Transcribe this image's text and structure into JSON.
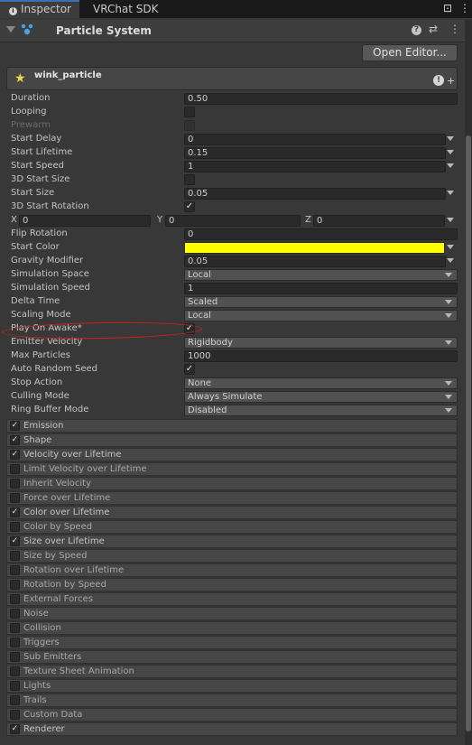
{
  "tabs": {
    "inspector": "Inspector",
    "vrchat": "VRChat SDK"
  },
  "component": {
    "title": "Particle System",
    "help_glyph": "?",
    "preset_glyph": "⇄",
    "menu_glyph": "⋮"
  },
  "open_editor": "Open Editor...",
  "system": {
    "name": "wink_particle",
    "info_glyph": "!",
    "plus_glyph": "+"
  },
  "properties": {
    "duration": {
      "label": "Duration",
      "value": "0.50"
    },
    "looping": {
      "label": "Looping",
      "checked": false
    },
    "prewarm": {
      "label": "Prewarm",
      "checked": false
    },
    "start_delay": {
      "label": "Start Delay",
      "value": "0"
    },
    "start_lifetime": {
      "label": "Start Lifetime",
      "value": "0.15"
    },
    "start_speed": {
      "label": "Start Speed",
      "value": "1"
    },
    "start_size_3d": {
      "label": "3D Start Size",
      "checked": false
    },
    "start_size": {
      "label": "Start Size",
      "value": "0.05"
    },
    "start_rotation_3d": {
      "label": "3D Start Rotation",
      "checked": true,
      "check_glyph": "✓"
    },
    "rotation_xyz": {
      "x_label": "X",
      "x_value": "0",
      "y_label": "Y",
      "y_value": "0",
      "z_label": "Z",
      "z_value": "0"
    },
    "flip_rotation": {
      "label": "Flip Rotation",
      "value": "0"
    },
    "start_color": {
      "label": "Start Color",
      "color": "#ffff00"
    },
    "gravity_modifier": {
      "label": "Gravity Modifier",
      "value": "0.05"
    },
    "simulation_space": {
      "label": "Simulation Space",
      "value": "Local"
    },
    "simulation_speed": {
      "label": "Simulation Speed",
      "value": "1"
    },
    "delta_time": {
      "label": "Delta Time",
      "value": "Scaled"
    },
    "scaling_mode": {
      "label": "Scaling Mode",
      "value": "Local"
    },
    "play_on_awake": {
      "label": "Play On Awake*",
      "checked": true,
      "check_glyph": "✓"
    },
    "emitter_velocity": {
      "label": "Emitter Velocity",
      "value": "Rigidbody"
    },
    "max_particles": {
      "label": "Max Particles",
      "value": "1000"
    },
    "auto_random_seed": {
      "label": "Auto Random Seed",
      "checked": true,
      "check_glyph": "✓"
    },
    "stop_action": {
      "label": "Stop Action",
      "value": "None"
    },
    "culling_mode": {
      "label": "Culling Mode",
      "value": "Always Simulate"
    },
    "ring_buffer_mode": {
      "label": "Ring Buffer Mode",
      "value": "Disabled"
    }
  },
  "modules": [
    {
      "label": "Emission",
      "checked": true,
      "check_glyph": "✓"
    },
    {
      "label": "Shape",
      "checked": true,
      "check_glyph": "✓"
    },
    {
      "label": "Velocity over Lifetime",
      "checked": true,
      "check_glyph": "✓"
    },
    {
      "label": "Limit Velocity over Lifetime",
      "checked": false,
      "check_glyph": ""
    },
    {
      "label": "Inherit Velocity",
      "checked": false,
      "check_glyph": ""
    },
    {
      "label": "Force over Lifetime",
      "checked": false,
      "check_glyph": ""
    },
    {
      "label": "Color over Lifetime",
      "checked": true,
      "check_glyph": "✓"
    },
    {
      "label": "Color by Speed",
      "checked": false,
      "check_glyph": ""
    },
    {
      "label": "Size over Lifetime",
      "checked": true,
      "check_glyph": "✓"
    },
    {
      "label": "Size by Speed",
      "checked": false,
      "check_glyph": ""
    },
    {
      "label": "Rotation over Lifetime",
      "checked": false,
      "check_glyph": ""
    },
    {
      "label": "Rotation by Speed",
      "checked": false,
      "check_glyph": ""
    },
    {
      "label": "External Forces",
      "checked": false,
      "check_glyph": ""
    },
    {
      "label": "Noise",
      "checked": false,
      "check_glyph": ""
    },
    {
      "label": "Collision",
      "checked": false,
      "check_glyph": ""
    },
    {
      "label": "Triggers",
      "checked": false,
      "check_glyph": ""
    },
    {
      "label": "Sub Emitters",
      "checked": false,
      "check_glyph": ""
    },
    {
      "label": "Texture Sheet Animation",
      "checked": false,
      "check_glyph": ""
    },
    {
      "label": "Lights",
      "checked": false,
      "check_glyph": ""
    },
    {
      "label": "Trails",
      "checked": false,
      "check_glyph": ""
    },
    {
      "label": "Custom Data",
      "checked": false,
      "check_glyph": ""
    },
    {
      "label": "Renderer",
      "checked": true,
      "check_glyph": "✓"
    }
  ],
  "colors": {
    "accent_tab": "#3a72b0",
    "annotation": "#d21e1e",
    "start_color": "#ffff00"
  }
}
